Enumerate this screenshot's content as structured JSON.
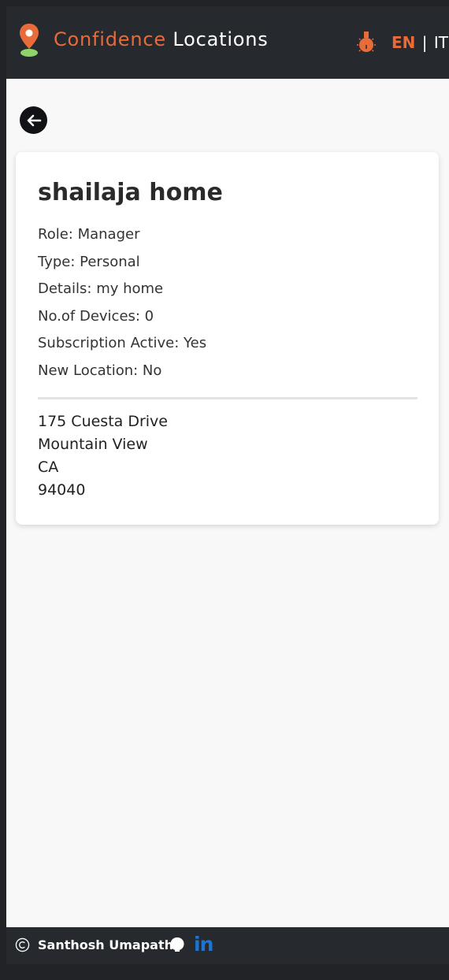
{
  "header": {
    "brand_part1": "Confidence",
    "brand_part2": "Locations",
    "lang_active": "EN",
    "lang_separator": "|",
    "lang_other": "IT"
  },
  "location": {
    "name": "shailaja home",
    "details": [
      "Role: Manager",
      "Type: Personal",
      "Details: my home",
      "No.of Devices: 0",
      "Subscription Active: Yes",
      "New Location: No"
    ],
    "address": [
      "175 Cuesta Drive",
      "Mountain View",
      "CA",
      "94040"
    ]
  },
  "footer": {
    "author": "Santhosh Umapathi",
    "linkedin_label": "in"
  },
  "colors": {
    "accent": "#e86b3a",
    "header_bg": "#26292e",
    "page_bg": "#f8f8f8",
    "linkedin": "#1c75d3"
  },
  "icons": [
    "map-pin-icon",
    "bulb-icon",
    "back-arrow-icon",
    "copyright-icon",
    "github-icon",
    "linkedin-icon"
  ]
}
